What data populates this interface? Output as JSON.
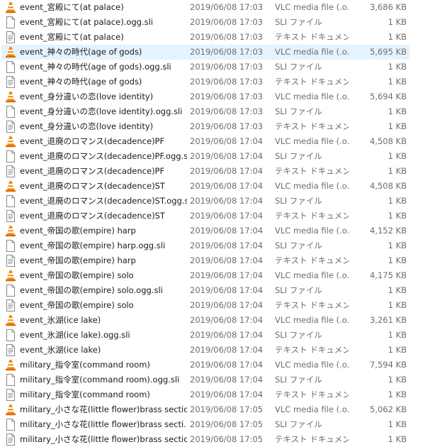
{
  "files": [
    {
      "icon": "vlc-cone-icon",
      "name": "event_宮殿にて(at palace)",
      "date": "2019/06/08 17:03",
      "type": "VLC media file (.o...",
      "size": "3,686 KB"
    },
    {
      "icon": "document-icon",
      "name": "event_宮殿にて(at palace).ogg.sli",
      "date": "2019/06/08 17:03",
      "type": "SLI ファイル",
      "size": "1 KB"
    },
    {
      "icon": "text-document-icon",
      "name": "event_宮殿にて(at palace)",
      "date": "2019/06/08 17:03",
      "type": "テキスト ドキュメント",
      "size": "1 KB"
    },
    {
      "icon": "vlc-cone-icon",
      "name": "event_神々の時代(age of gods)",
      "date": "2019/06/08 17:03",
      "type": "VLC media file (.o...",
      "size": "5,695 KB",
      "selected": true
    },
    {
      "icon": "document-icon",
      "name": "event_神々の時代(age of gods).ogg.sli",
      "date": "2019/06/08 17:03",
      "type": "SLI ファイル",
      "size": "1 KB"
    },
    {
      "icon": "text-document-icon",
      "name": "event_神々の時代(age of gods)",
      "date": "2019/06/08 17:03",
      "type": "テキスト ドキュメント",
      "size": "1 KB"
    },
    {
      "icon": "vlc-cone-icon",
      "name": "event_身分違いの恋(love identity)",
      "date": "2019/06/08 17:03",
      "type": "VLC media file (.o...",
      "size": "5,694 KB"
    },
    {
      "icon": "document-icon",
      "name": "event_身分違いの恋(love identity).ogg.sli",
      "date": "2019/06/08 17:03",
      "type": "SLI ファイル",
      "size": "1 KB"
    },
    {
      "icon": "text-document-icon",
      "name": "event_身分違いの恋(love identity)",
      "date": "2019/06/08 17:03",
      "type": "テキスト ドキュメント",
      "size": "1 KB"
    },
    {
      "icon": "vlc-cone-icon",
      "name": "event_退廃のロマンス(decadence)PF",
      "date": "2019/06/08 17:04",
      "type": "VLC media file (.o...",
      "size": "4,508 KB"
    },
    {
      "icon": "document-icon",
      "name": "event_退廃のロマンス(decadence)PF.ogg.sli",
      "date": "2019/06/08 17:04",
      "type": "SLI ファイル",
      "size": "1 KB"
    },
    {
      "icon": "text-document-icon",
      "name": "event_退廃のロマンス(decadence)PF",
      "date": "2019/06/08 17:04",
      "type": "テキスト ドキュメント",
      "size": "1 KB"
    },
    {
      "icon": "vlc-cone-icon",
      "name": "event_退廃のロマンス(decadence)ST",
      "date": "2019/06/08 17:04",
      "type": "VLC media file (.o...",
      "size": "4,508 KB"
    },
    {
      "icon": "document-icon",
      "name": "event_退廃のロマンス(decadence)ST.ogg.sli",
      "date": "2019/06/08 17:04",
      "type": "SLI ファイル",
      "size": "1 KB"
    },
    {
      "icon": "text-document-icon",
      "name": "event_退廃のロマンス(decadence)ST",
      "date": "2019/06/08 17:04",
      "type": "テキスト ドキュメント",
      "size": "1 KB"
    },
    {
      "icon": "vlc-cone-icon",
      "name": "event_帝国の歌(empire) harp",
      "date": "2019/06/08 17:04",
      "type": "VLC media file (.o...",
      "size": "4,152 KB"
    },
    {
      "icon": "document-icon",
      "name": "event_帝国の歌(empire) harp.ogg.sli",
      "date": "2019/06/08 17:04",
      "type": "SLI ファイル",
      "size": "1 KB"
    },
    {
      "icon": "text-document-icon",
      "name": "event_帝国の歌(empire) harp",
      "date": "2019/06/08 17:04",
      "type": "テキスト ドキュメント",
      "size": "1 KB"
    },
    {
      "icon": "vlc-cone-icon",
      "name": "event_帝国の歌(empire) solo",
      "date": "2019/06/08 17:04",
      "type": "VLC media file (.o...",
      "size": "4,175 KB"
    },
    {
      "icon": "document-icon",
      "name": "event_帝国の歌(empire) solo.ogg.sli",
      "date": "2019/06/08 17:04",
      "type": "SLI ファイル",
      "size": "1 KB"
    },
    {
      "icon": "text-document-icon",
      "name": "event_帝国の歌(empire) solo",
      "date": "2019/06/08 17:04",
      "type": "テキスト ドキュメント",
      "size": "1 KB"
    },
    {
      "icon": "vlc-cone-icon",
      "name": "event_氷湖(ice lake)",
      "date": "2019/06/08 17:04",
      "type": "VLC media file (.o...",
      "size": "3,261 KB"
    },
    {
      "icon": "document-icon",
      "name": "event_氷湖(ice lake).ogg.sli",
      "date": "2019/06/08 17:04",
      "type": "SLI ファイル",
      "size": "1 KB"
    },
    {
      "icon": "text-document-icon",
      "name": "event_氷湖(ice lake)",
      "date": "2019/06/08 17:04",
      "type": "テキスト ドキュメント",
      "size": "1 KB"
    },
    {
      "icon": "vlc-cone-icon",
      "name": "military_指令室(command room)",
      "date": "2019/06/08 17:04",
      "type": "VLC media file (.o...",
      "size": "7,594 KB"
    },
    {
      "icon": "document-icon",
      "name": "military_指令室(command room).ogg.sli",
      "date": "2019/06/08 17:04",
      "type": "SLI ファイル",
      "size": "1 KB"
    },
    {
      "icon": "text-document-icon",
      "name": "military_指令室(command room)",
      "date": "2019/06/08 17:04",
      "type": "テキスト ドキュメント",
      "size": "1 KB"
    },
    {
      "icon": "vlc-cone-icon",
      "name": "military_小さな花(little flower)brass section",
      "date": "2019/06/08 17:05",
      "type": "VLC media file (.o...",
      "size": "5,062 KB"
    },
    {
      "icon": "document-icon",
      "name": "military_小さな花(little flower)brass secti...",
      "date": "2019/06/08 17:05",
      "type": "SLI ファイル",
      "size": "1 KB"
    },
    {
      "icon": "text-document-icon",
      "name": "military_小さな花(little flower)brass section",
      "date": "2019/06/08 17:05",
      "type": "テキスト ドキュメント",
      "size": "1 KB"
    }
  ],
  "colors": {
    "selection": "#e5f3ff",
    "secondary_text": "#6d6d6d",
    "vlc_orange": "#f08a00"
  }
}
